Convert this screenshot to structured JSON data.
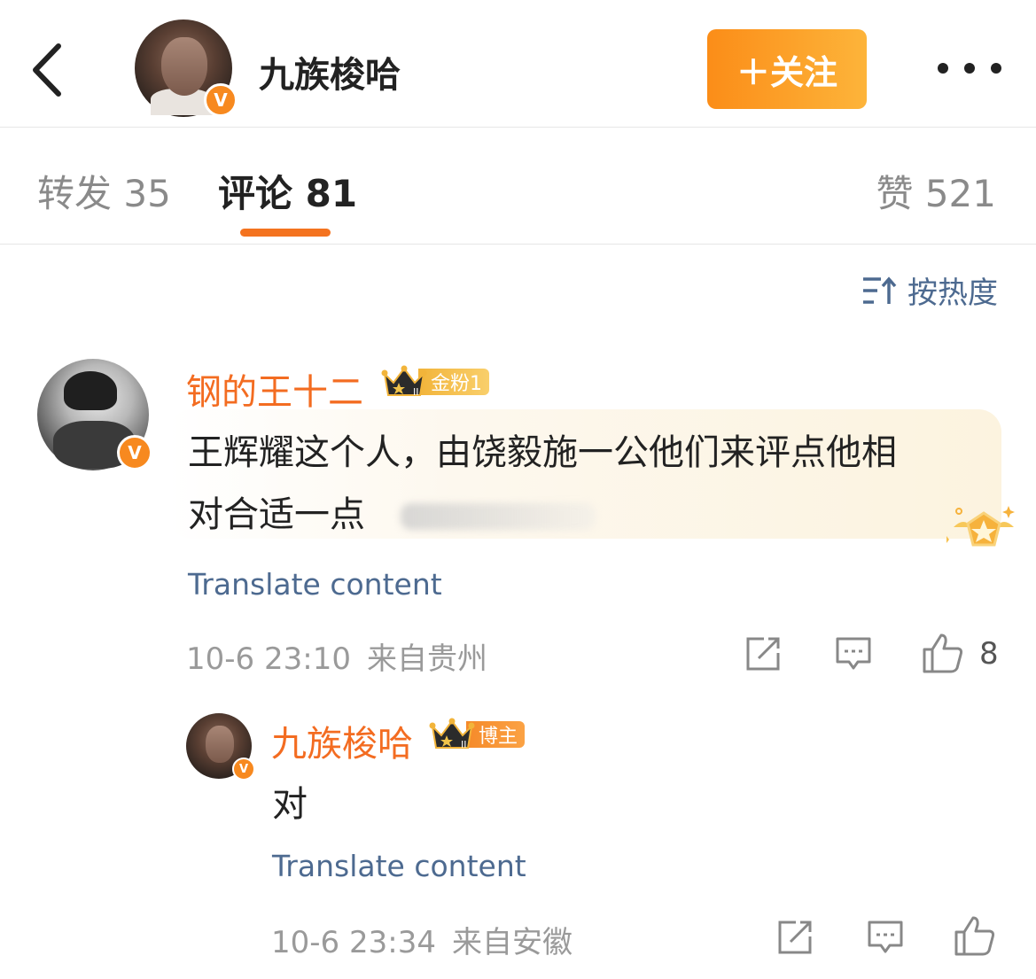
{
  "header": {
    "title": "九族梭哈",
    "follow_label": "＋关注",
    "verified_mark": "V"
  },
  "tabs": {
    "repost_label": "转发",
    "repost_count": "35",
    "comment_label": "评论",
    "comment_count": "81",
    "like_label": "赞",
    "like_count": "521"
  },
  "sort": {
    "label": "按热度"
  },
  "comments": [
    {
      "username": "钢的王十二",
      "badge_text": "金粉1",
      "crown_level": "II",
      "text_line1": "王辉耀这个人，由饶毅施一公他们来评点他相",
      "text_line2": "对合适一点",
      "translate_label": "Translate content",
      "date": "10-6 23:10",
      "location": "来自贵州",
      "likes": "8",
      "verified_mark": "V"
    },
    {
      "username": "九族梭哈",
      "badge_text": "博主",
      "crown_level": "II",
      "text": "对",
      "translate_label": "Translate content",
      "date": "10-6 23:34",
      "location": "来自安徽",
      "verified_mark": "V"
    }
  ],
  "colors": {
    "accent": "#f36c21",
    "link": "#4d6a90",
    "follow_gradient_start": "#fb8d18",
    "follow_gradient_end": "#fdb43a"
  }
}
